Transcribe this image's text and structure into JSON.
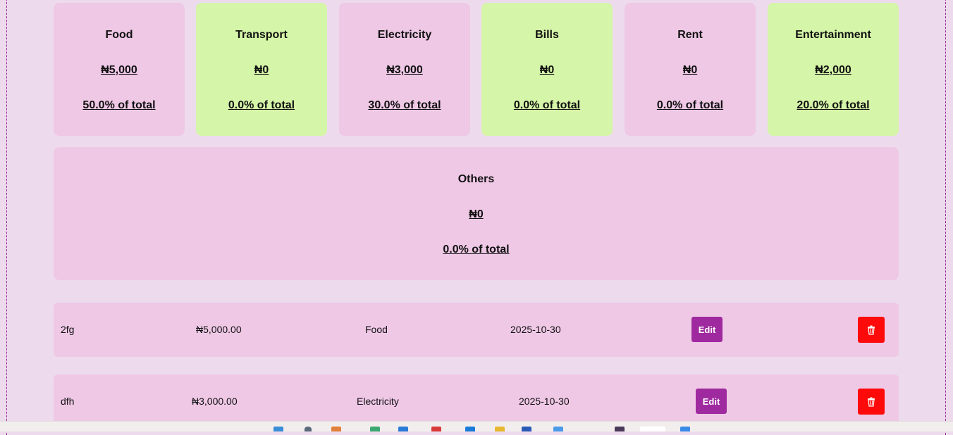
{
  "categories": [
    {
      "name": "Food",
      "amount": "₦5,000",
      "percent": "50.0% of total",
      "color": "#efc8e6"
    },
    {
      "name": "Transport",
      "amount": "₦0",
      "percent": "0.0% of total",
      "color": "#d5f5a8"
    },
    {
      "name": "Electricity",
      "amount": "₦3,000",
      "percent": "30.0% of total",
      "color": "#efc8e6"
    },
    {
      "name": "Bills",
      "amount": "₦0",
      "percent": "0.0% of total",
      "color": "#d5f5a8"
    },
    {
      "name": "Rent",
      "amount": "₦0",
      "percent": "0.0% of total",
      "color": "#efc8e6"
    },
    {
      "name": "Entertainment",
      "amount": "₦2,000",
      "percent": "20.0% of total",
      "color": "#d5f5a8"
    }
  ],
  "others": {
    "name": "Others",
    "amount": "₦0",
    "percent": "0.0% of total"
  },
  "expenses": [
    {
      "description": "2fg",
      "amount": "₦5,000.00",
      "category": "Food",
      "date": "2025-10-30",
      "edit_label": "Edit"
    },
    {
      "description": "dfh",
      "amount": "₦3,000.00",
      "category": "Electricity",
      "date": "2025-10-30",
      "edit_label": "Edit"
    }
  ],
  "colors": {
    "accent": "#9f2a9f",
    "danger": "#ff0a0a",
    "card_pink": "#efc8e6",
    "card_green": "#d5f5a8",
    "background": "#eddbed"
  },
  "icons": {
    "delete": "trash-icon"
  }
}
